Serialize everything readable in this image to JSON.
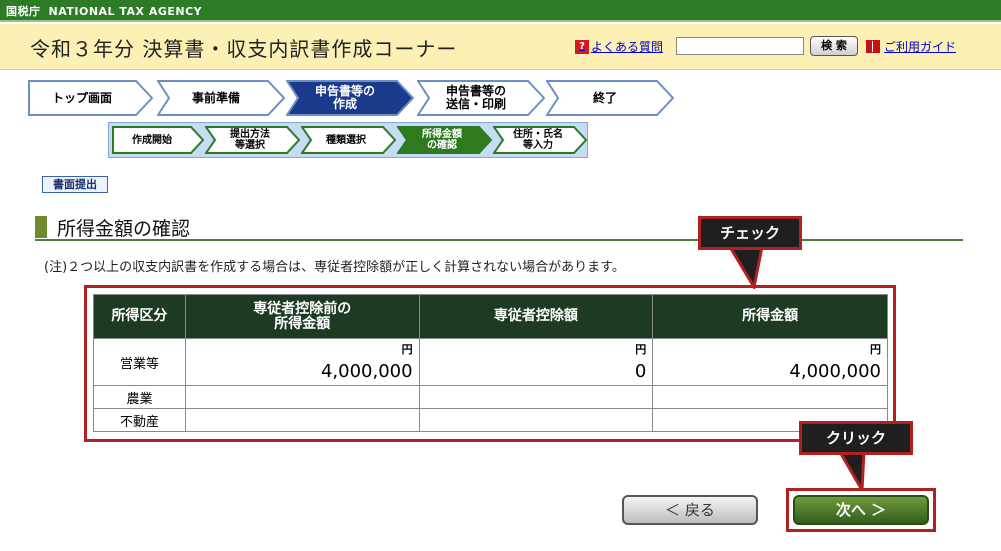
{
  "agency": {
    "logo": "国税庁",
    "name": "NATIONAL TAX AGENCY"
  },
  "header": {
    "title": "令和３年分 決算書・収支内訳書作成コーナー",
    "faq_label": "よくある質問",
    "search_value": "",
    "search_button_label": "検 索",
    "guide_label": "ご利用ガイド"
  },
  "steps": [
    {
      "label": "トップ画面",
      "active": false
    },
    {
      "label": "事前準備",
      "active": false
    },
    {
      "label": "申告書等の\n作成",
      "active": true
    },
    {
      "label": "申告書等の\n送信・印刷",
      "active": false
    },
    {
      "label": "終了",
      "active": false
    }
  ],
  "substeps": [
    {
      "label": "作成開始",
      "active": false
    },
    {
      "label": "提出方法\n等選択",
      "active": false
    },
    {
      "label": "種類選択",
      "active": false
    },
    {
      "label": "所得金額\nの確認",
      "active": true
    },
    {
      "label": "住所・氏名\n等入力",
      "active": false
    }
  ],
  "paper_submission_label": "書面提出",
  "section_title": "所得金額の確認",
  "note": "(注)２つ以上の収支内訳書を作成する場合は、専従者控除額が正しく計算されない場合があります。",
  "table": {
    "headers": [
      "所得区分",
      "専従者控除前の\n所得金額",
      "専従者控除額",
      "所得金額"
    ],
    "unit": "円",
    "rows": [
      {
        "label": "営業等",
        "values": [
          "4,000,000",
          "0",
          "4,000,000"
        ]
      },
      {
        "label": "農業",
        "values": [
          "",
          "",
          ""
        ]
      },
      {
        "label": "不動産",
        "values": [
          "",
          "",
          ""
        ]
      }
    ]
  },
  "callouts": {
    "check": "チェック",
    "click": "クリック"
  },
  "buttons": {
    "back": "＜ 戻る",
    "next": "次へ ＞"
  },
  "colors": {
    "accent_green": "#2d7a27",
    "active_step": "#1a3a8c",
    "highlight_red": "#b32020"
  }
}
